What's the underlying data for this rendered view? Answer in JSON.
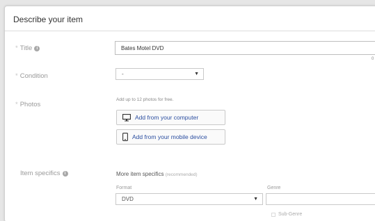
{
  "panel": {
    "title": "Describe your item"
  },
  "title_row": {
    "label": "Title",
    "value": "Bates Motel DVD",
    "char_count": "0"
  },
  "condition_row": {
    "label": "Condition",
    "selected": "-"
  },
  "photos_row": {
    "label": "Photos",
    "hint": "Add up to 12 photos for free.",
    "btn_computer": "Add from your computer",
    "btn_mobile": "Add from your mobile device"
  },
  "specifics_row": {
    "label": "Item specifics",
    "heading": "More item specifics",
    "heading_note": "(recommended)",
    "format_label": "Format",
    "format_value": "DVD",
    "genre_label": "Genre",
    "subgenre_label": "Sub-Genre"
  },
  "icons": [
    "info-icon",
    "monitor-icon",
    "mobile-icon",
    "chevron-down-icon"
  ]
}
